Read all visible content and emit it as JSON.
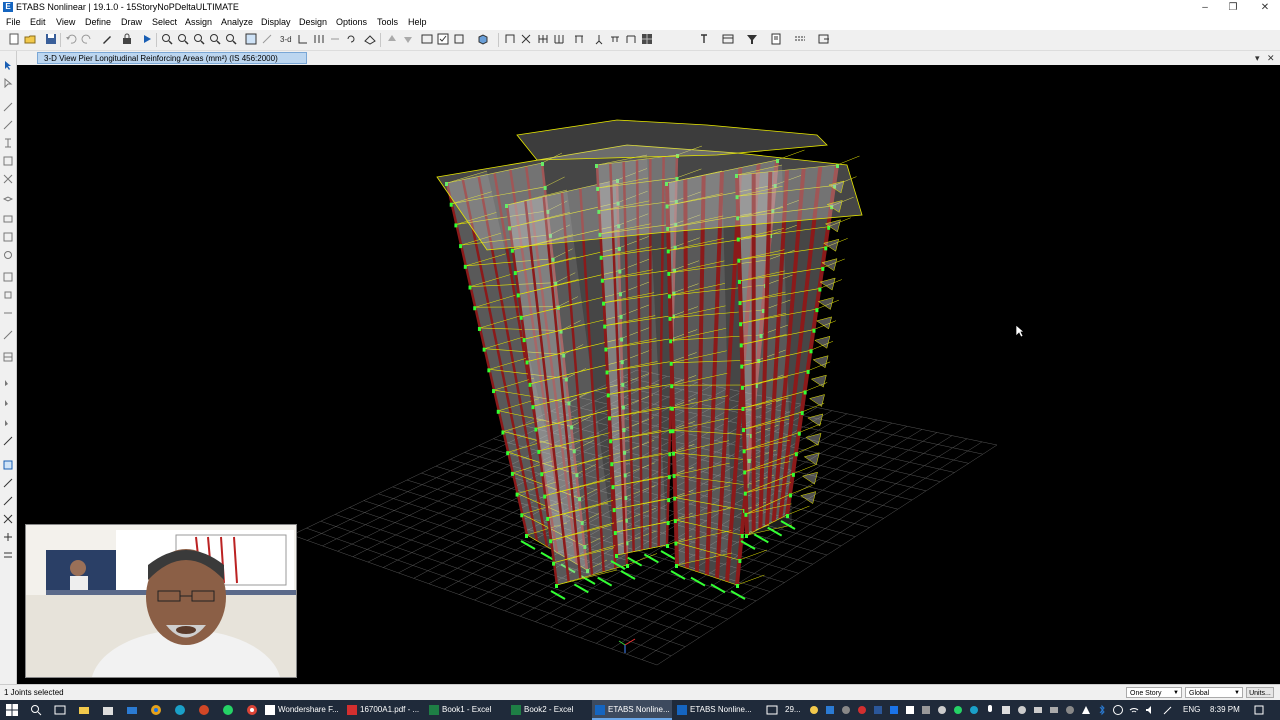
{
  "window": {
    "title": "ETABS Nonlinear | 19.1.0 - 15StoryNoPDeltaULTIMATE",
    "controls": [
      "minimize",
      "restore",
      "close"
    ]
  },
  "menu": [
    "File",
    "Edit",
    "View",
    "Define",
    "Draw",
    "Select",
    "Assign",
    "Analyze",
    "Display",
    "Design",
    "Options",
    "Tools",
    "Help"
  ],
  "toolbar": {
    "view_3d_label": "3-d"
  },
  "view": {
    "tab_title": "3-D View  Pier Longitudinal Reinforcing Areas (mm²)  (IS 456:2000)",
    "menu_arrow": "▾",
    "close": "✕"
  },
  "status": {
    "selection": "1 Joints selected",
    "story_option": "One Story",
    "coord_system": "Global",
    "units_label": "Units..."
  },
  "taskbar": {
    "apps": [
      {
        "label": "Wondershare F...",
        "icon": "wondershare-icon",
        "color": "#ffffff"
      },
      {
        "label": "16700A1.pdf - ...",
        "icon": "pdf-icon",
        "color": "#d32f2f"
      },
      {
        "label": "Book1 - Excel",
        "icon": "excel-icon",
        "color": "#1e7e45"
      },
      {
        "label": "Book2 - Excel",
        "icon": "excel-icon",
        "color": "#1e7e45"
      },
      {
        "label": "ETABS Nonline...",
        "icon": "etabs-icon",
        "color": "#1565c0"
      },
      {
        "label": "ETABS Nonline...",
        "icon": "etabs-icon",
        "color": "#1565c0"
      }
    ],
    "weather": "29...",
    "language": "ENG",
    "time": "8:39 PM"
  },
  "colors": {
    "viewport_bg": "#000000",
    "column": "#8b1a1a",
    "beam": "#e8e800",
    "slab": "#c8c8c8",
    "support": "#33ff33",
    "grid": "#555555",
    "taskbar": "#1f2a3a",
    "active_tab": "#bcd6f0"
  }
}
